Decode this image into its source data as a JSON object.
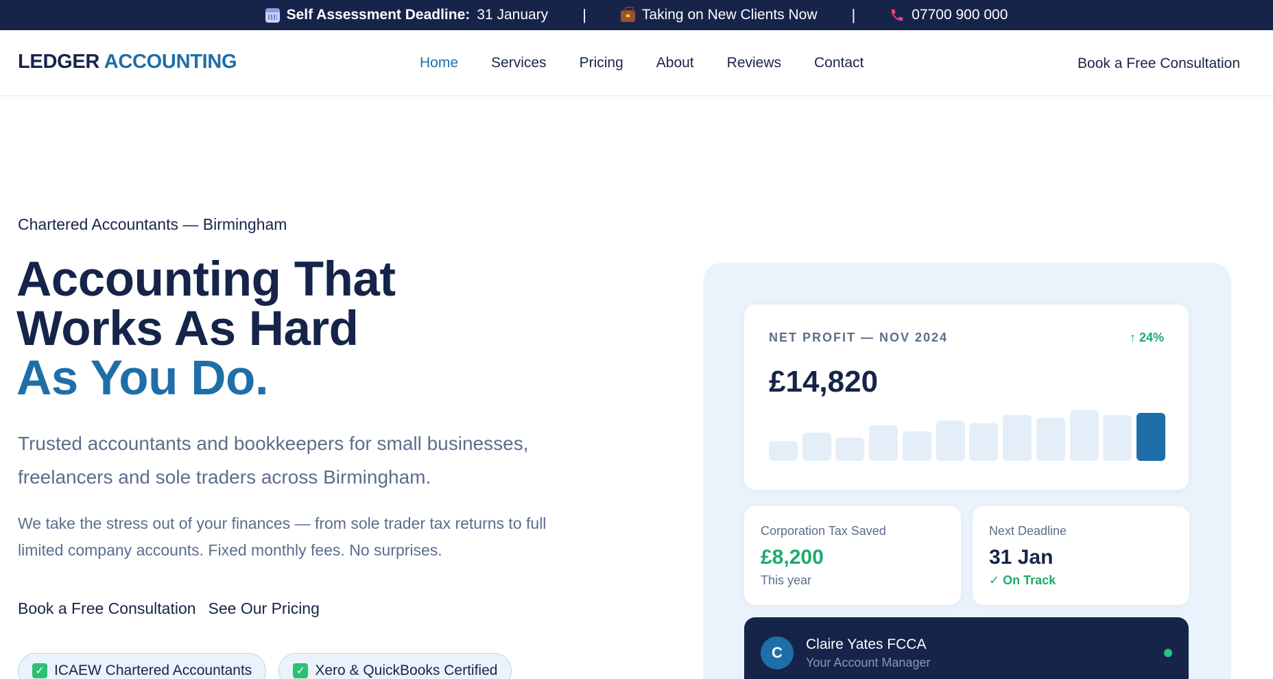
{
  "topbar": {
    "deadline_label": "Self Assessment Deadline:",
    "deadline_value": "31 January",
    "separator": "|",
    "clients_text": "Taking on New Clients Now",
    "phone": "07700 900 000",
    "icons": [
      "calendar-icon",
      "briefcase-icon",
      "phone-icon"
    ]
  },
  "brand": {
    "part1": "LEDGER",
    "part2": "ACCOUNTING"
  },
  "nav": {
    "items": [
      {
        "label": "Home",
        "active": true
      },
      {
        "label": "Services"
      },
      {
        "label": "Pricing"
      },
      {
        "label": "About"
      },
      {
        "label": "Reviews"
      },
      {
        "label": "Contact"
      }
    ],
    "cta": "Book a Free Consultation"
  },
  "hero": {
    "eyebrow": "Chartered Accountants — Birmingham",
    "headline_line1": "Accounting That",
    "headline_line2": "Works As Hard",
    "headline_accent": "As You Do.",
    "lead": "Trusted accountants and bookkeepers for small businesses, freelancers and sole traders across Birmingham.",
    "body": "We take the stress out of your finances — from sole trader tax returns to full limited company accounts. Fixed monthly fees. No surprises.",
    "cta_primary": "Book a Free Consultation",
    "cta_secondary": "See Our Pricing",
    "badges": [
      "ICAEW Chartered Accountants",
      "Xero & QuickBooks Certified"
    ]
  },
  "dashboard": {
    "profit_label": "NET PROFIT — NOV 2024",
    "profit_delta": "↑ 24%",
    "profit_value": "£14,820",
    "bar_levels": [
      0.42,
      0.58,
      0.48,
      0.74,
      0.62,
      0.84,
      0.78,
      0.95,
      0.9,
      1.05,
      0.95,
      1.0
    ],
    "tax_label": "Corporation Tax Saved",
    "tax_value": "£8,200",
    "tax_sub": "This year",
    "deadline_label": "Next Deadline",
    "deadline_value": "31 Jan",
    "deadline_status": "✓ On Track",
    "manager_initial": "C",
    "manager_name": "Claire Yates FCCA",
    "manager_role": "Your Account Manager"
  },
  "colors": {
    "navy": "#16244a",
    "brand_blue": "#1e6fa8",
    "green": "#1faa6b",
    "panel_bg": "#eaf3fb"
  }
}
